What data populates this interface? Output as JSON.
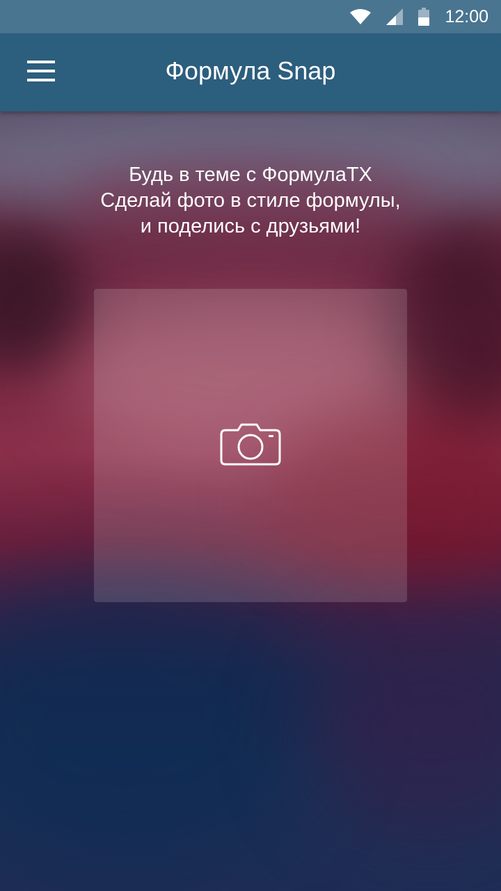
{
  "status_bar": {
    "time": "12:00",
    "icons": [
      "wifi-icon",
      "cellular-signal-icon",
      "battery-icon"
    ]
  },
  "app_bar": {
    "title": "Формула Snap",
    "menu_icon": "hamburger-menu-icon"
  },
  "intro": {
    "line1": "Будь в теме с ФормулаTX",
    "line2": "Сделай фото в стиле формулы,",
    "line3": "и поделись с друзьями!"
  },
  "photo_area": {
    "icon": "camera-icon"
  },
  "colors": {
    "status_bar": "#4a7590",
    "app_bar": "#2c5e7e",
    "text": "#ffffff"
  }
}
